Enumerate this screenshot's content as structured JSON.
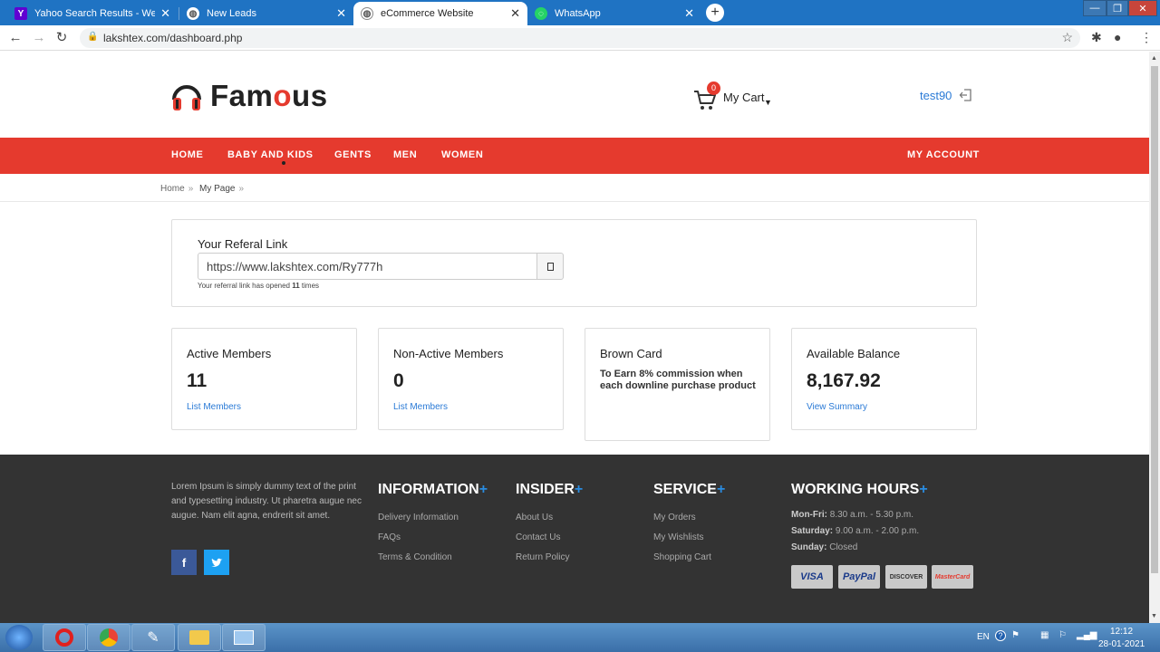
{
  "browser": {
    "tabs": [
      {
        "title": "Yahoo Search Results - Web sear",
        "favicon": "Y",
        "favicon_color": "#6001d2",
        "active": false
      },
      {
        "title": "New Leads",
        "favicon": "globe",
        "favicon_color": "#5f6368",
        "active": false
      },
      {
        "title": "eCommerce Website",
        "favicon": "globe",
        "favicon_color": "#5f6368",
        "active": true
      },
      {
        "title": "WhatsApp",
        "favicon": "wa",
        "favicon_color": "#25d366",
        "active": false
      }
    ],
    "url": "lakshtex.com/dashboard.php"
  },
  "site": {
    "brand_prefix": "Fam",
    "brand_o": "o",
    "brand_suffix": "us",
    "cart_count": "0",
    "cart_label": "My Cart",
    "username": "test90",
    "nav": {
      "home": "HOME",
      "baby_kids": "BABY AND KIDS",
      "gents": "GENTS",
      "men": "MEN",
      "women": "WOMEN",
      "account": "MY ACCOUNT"
    },
    "breadcrumb": {
      "home": "Home",
      "current": "My Page"
    },
    "accent_color": "#e53a2e",
    "link_color": "#2a7ad6"
  },
  "referral": {
    "label": "Your Referal Link",
    "link": "https://www.lakshtex.com/Ry777h",
    "note_prefix": "Your referral link has opened ",
    "note_count": "11",
    "note_suffix": " times"
  },
  "stats": {
    "active": {
      "title": "Active Members",
      "value": "11",
      "link": "List Members"
    },
    "nonactive": {
      "title": "Non-Active Members",
      "value": "0",
      "link": "List Members"
    },
    "brown": {
      "title": "Brown Card",
      "desc": "To Earn 8% commission when each downline purchase product"
    },
    "balance": {
      "title": "Available Balance",
      "value": "8,167.92",
      "link": "View Summary"
    }
  },
  "footer": {
    "about": "Lorem Ipsum is simply dummy text of the print and typesetting industry. Ut pharetra augue nec augue. Nam elit agna, endrerit sit amet.",
    "information": {
      "head": "INFORMATION",
      "links": [
        "Delivery Information",
        "FAQs",
        "Terms & Condition"
      ]
    },
    "insider": {
      "head": "INSIDER",
      "links": [
        "About Us",
        "Contact Us",
        "Return Policy"
      ]
    },
    "service": {
      "head": "SERVICE",
      "links": [
        "My Orders",
        "My Wishlists",
        "Shopping Cart"
      ]
    },
    "hours": {
      "head": "WORKING HOURS",
      "rows": [
        {
          "day": "Mon-Fri:",
          "time": " 8.30 a.m. - 5.30 p.m."
        },
        {
          "day": "Saturday:",
          "time": " 9.00 a.m. - 2.00 p.m."
        },
        {
          "day": "Sunday:",
          "time": " Closed"
        }
      ]
    },
    "plus": "+",
    "cards": [
      "VISA",
      "PayPal",
      "DISCOVER",
      "MasterCard"
    ]
  },
  "taskbar": {
    "lang": "EN",
    "time": "12:12",
    "date": "28-01-2021"
  }
}
